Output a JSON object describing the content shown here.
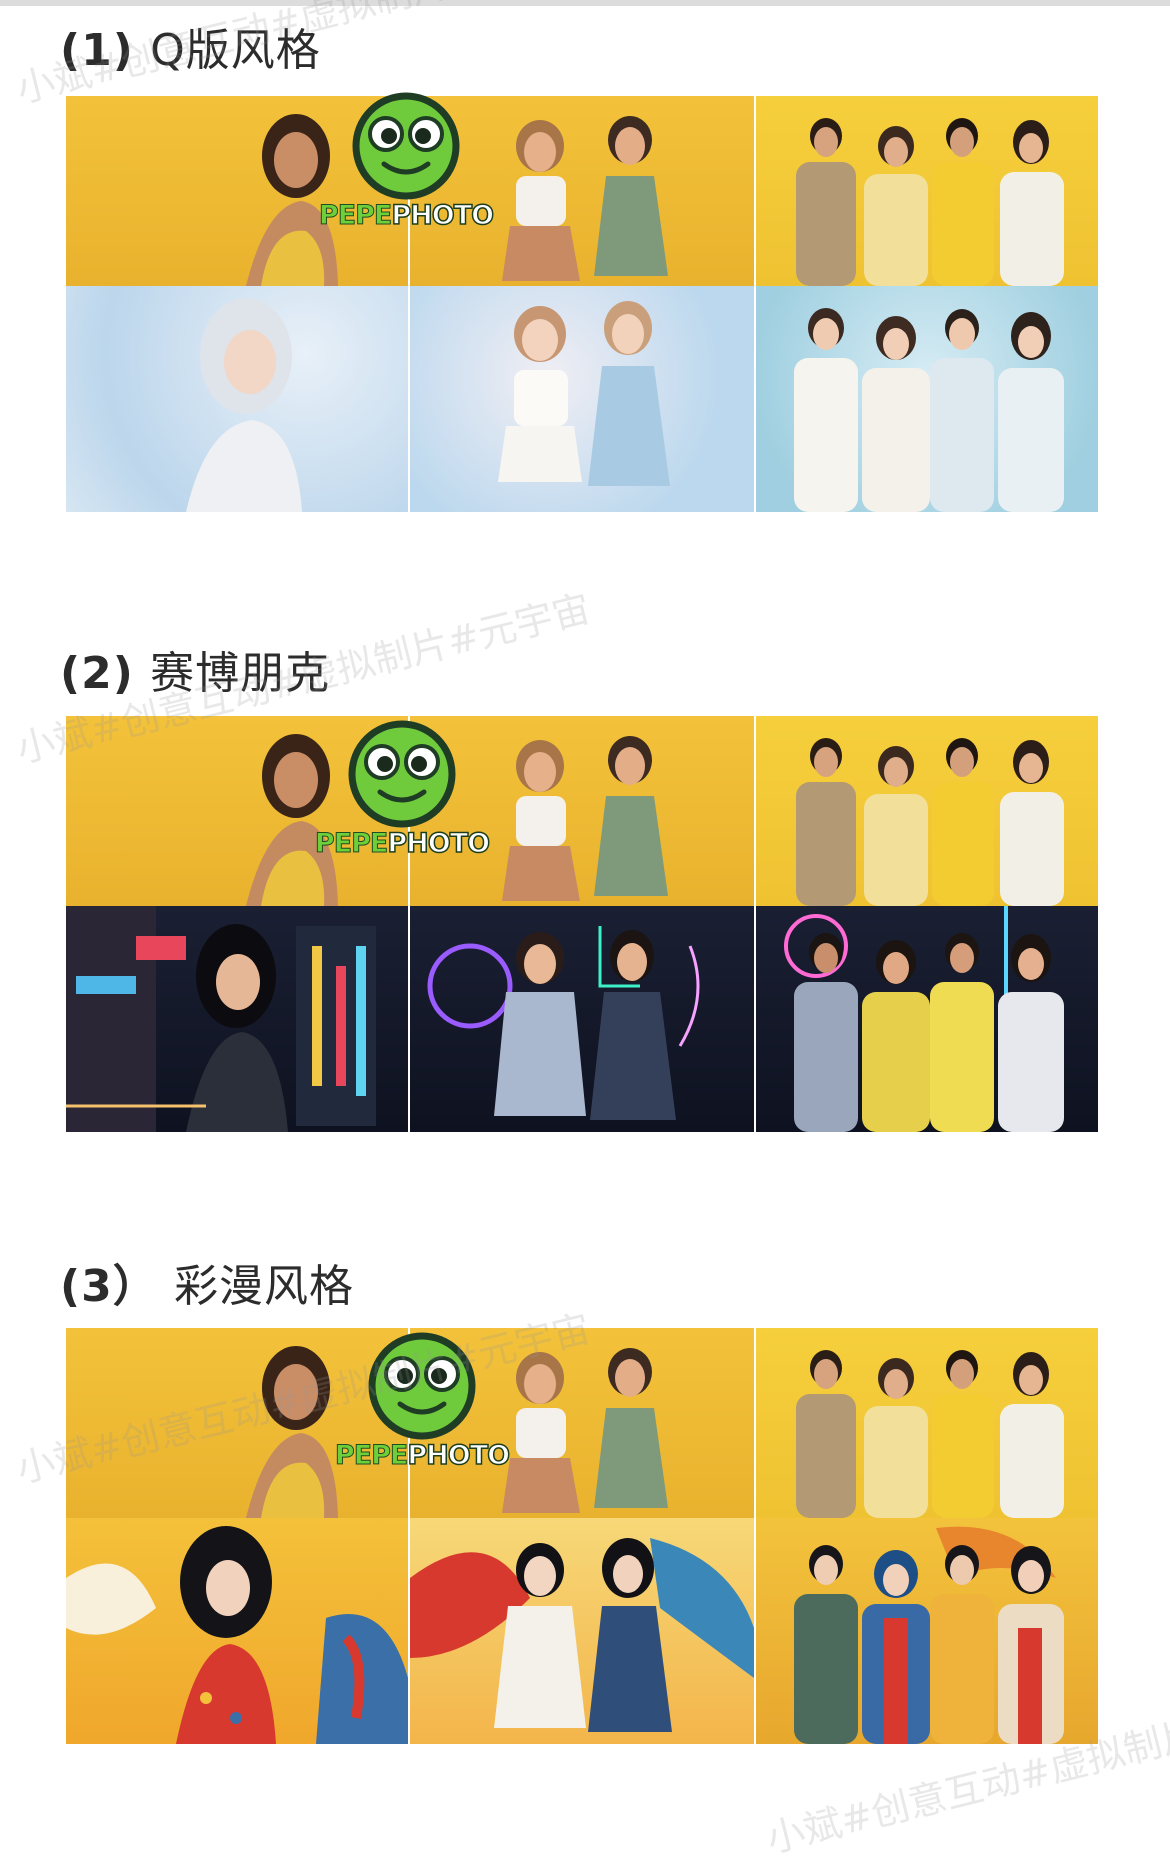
{
  "sections": [
    {
      "heading_num": "(1)",
      "heading_text": "Q版风格",
      "style": "chibi"
    },
    {
      "heading_num": "(2)",
      "heading_text": "赛博朋克",
      "style": "cyber"
    },
    {
      "heading_num": "(3）",
      "heading_text": "彩漫风格",
      "style": "comic"
    }
  ],
  "logo": {
    "word1": "PEPE",
    "word2": "PHOTO",
    "icon": "pepe-frog-icon"
  },
  "watermark": "小斌#创意互动#虚拟制片#元宇宙",
  "colors": {
    "accent_yellow": "#f3c23a",
    "logo_green": "#6fcf3a"
  }
}
